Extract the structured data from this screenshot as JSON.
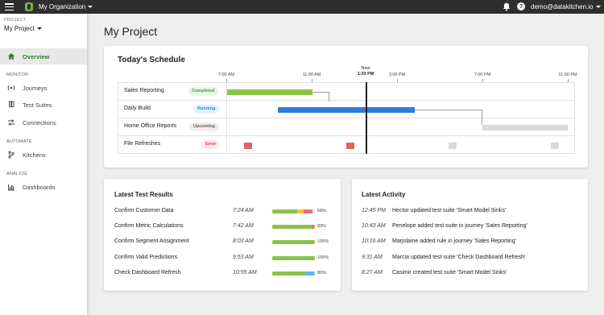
{
  "topbar": {
    "org_name": "My Organization",
    "user_email": "demo@datakitchen.io",
    "help_glyph": "?"
  },
  "sidebar": {
    "project_label": "PROJECT",
    "project_name": "My Project",
    "overview": "Overview",
    "monitor_label": "MONITOR",
    "journeys": "Journeys",
    "test_suites": "Test Suites",
    "connections": "Connections",
    "automate_label": "AUTOMATE",
    "kitchens": "Kitchens",
    "analyze_label": "ANALYZE",
    "dashboards": "Dashboards"
  },
  "page": {
    "title": "My Project"
  },
  "schedule": {
    "title": "Today's Schedule",
    "now_label": "Now",
    "time_labels": [
      "7:00 AM",
      "11:00 AM",
      "1:33 PM",
      "3:00 PM",
      "7:00 PM",
      "11:00 PM"
    ],
    "rows": [
      {
        "name": "Sales Reporting",
        "status": "Completed",
        "badge_bg": "#e8f5e9",
        "badge_fg": "#43a047"
      },
      {
        "name": "Daily Build",
        "status": "Running",
        "badge_bg": "#e3f2fd",
        "badge_fg": "#1e88e5"
      },
      {
        "name": "Home Office Reports",
        "status": "Upcoming",
        "badge_bg": "#eeeeee",
        "badge_fg": "#616161"
      },
      {
        "name": "File Refreshes",
        "status": "Error",
        "badge_bg": "#ffebee",
        "badge_fg": "#e53935"
      }
    ],
    "colors": {
      "completed": "#8bc34a",
      "running": "#2e7bde",
      "upcoming": "#d9d9d9",
      "error": "#d9665f"
    }
  },
  "tests": {
    "title": "Latest Test Results",
    "rows": [
      {
        "name": "Confirm Customer Data",
        "time": "7:24 AM",
        "pct": "58%",
        "segments": [
          {
            "w": 58,
            "c": "#8bc34a"
          },
          {
            "w": 15,
            "c": "#fbc02d"
          },
          {
            "w": 22,
            "c": "#e57373"
          }
        ]
      },
      {
        "name": "Confirm Metric Calculations",
        "time": "7:42 AM",
        "pct": "93%",
        "segments": [
          {
            "w": 93,
            "c": "#8bc34a"
          },
          {
            "w": 7,
            "c": "#e57373"
          }
        ]
      },
      {
        "name": "Confirm Segment Assignment",
        "time": "8:03 AM",
        "pct": "100%",
        "segments": [
          {
            "w": 100,
            "c": "#8bc34a"
          }
        ]
      },
      {
        "name": "Confirm Valid Predictions",
        "time": "9:53 AM",
        "pct": "100%",
        "segments": [
          {
            "w": 100,
            "c": "#8bc34a"
          }
        ]
      },
      {
        "name": "Check Dashboard Refresh",
        "time": "10:55 AM",
        "pct": "80%",
        "segments": [
          {
            "w": 80,
            "c": "#8bc34a"
          },
          {
            "w": 20,
            "c": "#64b5f6"
          }
        ]
      }
    ]
  },
  "activity": {
    "title": "Latest Activity",
    "rows": [
      {
        "time": "12:45 PM",
        "text": "Hector updated test suite 'Smart Model Sinks'"
      },
      {
        "time": "10:43 AM",
        "text": "Penelope added test suite in journey 'Sales Reporting'"
      },
      {
        "time": "10:16 AM",
        "text": "Marjolaine added rule in journey 'Sales Reporting'"
      },
      {
        "time": "9:31 AM",
        "text": "Marcia updated test suite 'Check Dashboard Refresh'"
      },
      {
        "time": "8:27 AM",
        "text": "Casimir created test suite 'Smart Model Sinks'"
      }
    ]
  }
}
